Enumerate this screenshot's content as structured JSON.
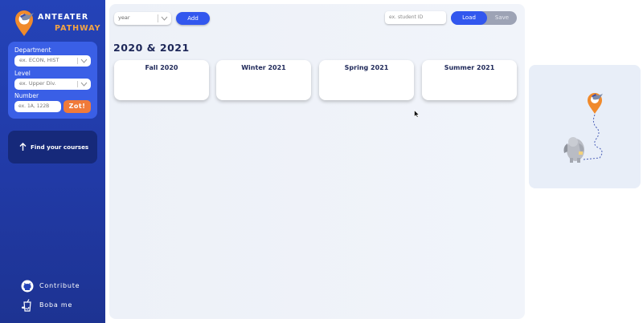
{
  "app": {
    "logo_line1": "ANTEATER",
    "logo_line2": "PATHWAY",
    "accent_orange": "#f5a443",
    "brand_blue": "#2443b8"
  },
  "sidebar": {
    "department_label": "Department",
    "department_placeholder": "ex. ECON, HIST",
    "level_label": "Level",
    "level_placeholder": "ex. Upper Div.",
    "number_label": "Number",
    "number_placeholder": "ex. 1A, 122B",
    "search_button": "Zot!",
    "find_courses": "Find your courses",
    "footer": [
      {
        "label": "Contribute",
        "icon": "github-icon"
      },
      {
        "label": "Boba me",
        "icon": "boba-icon"
      }
    ]
  },
  "toolbar": {
    "year_placeholder": "year",
    "add_label": "Add",
    "student_id_placeholder": "ex. student ID",
    "load_label": "Load",
    "save_label": "Save"
  },
  "planner": {
    "year_title": "2020 & 2021",
    "terms": [
      "Fall 2020",
      "Winter 2021",
      "Spring 2021",
      "Summer 2021"
    ]
  }
}
